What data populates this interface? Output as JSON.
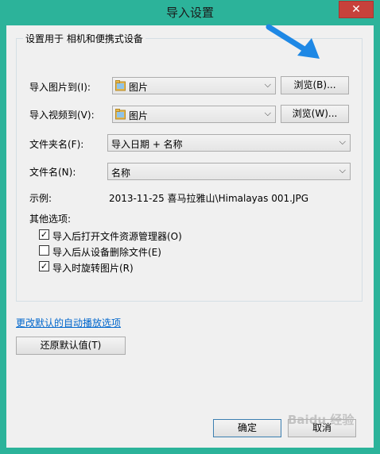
{
  "window": {
    "title": "导入设置",
    "close_symbol": "✕"
  },
  "group": {
    "label": "设置用于 相机和便携式设备"
  },
  "import_pictures": {
    "label": "导入图片到(I):",
    "value": "图片",
    "icon": "folder-icon",
    "browse_label": "浏览(B)..."
  },
  "import_videos": {
    "label": "导入视频到(V):",
    "value": "图片",
    "icon": "folder-icon",
    "browse_label": "浏览(W)..."
  },
  "folder_name": {
    "label": "文件夹名(F):",
    "value": "导入日期 + 名称"
  },
  "file_name": {
    "label": "文件名(N):",
    "value": "名称"
  },
  "example": {
    "label": "示例:",
    "value": "2013-11-25 喜马拉雅山\\Himalayas 001.JPG"
  },
  "other_options": {
    "label": "其他选项:",
    "items": [
      {
        "label": "导入后打开文件资源管理器(O)",
        "checked": true
      },
      {
        "label": "导入后从设备删除文件(E)",
        "checked": false
      },
      {
        "label": "导入时旋转图片(R)",
        "checked": true
      }
    ]
  },
  "autoplay_link": "更改默认的自动播放选项",
  "restore_defaults_label": "还原默认值(T)",
  "ok_label": "确定",
  "cancel_label": "取消",
  "watermark": "Baidu 经验",
  "colors": {
    "frame": "#2cb39a",
    "client": "#f0f0f0",
    "close": "#c7413b",
    "link": "#0066cc",
    "arrow": "#1e88e5",
    "folder": "#e8b84a"
  }
}
